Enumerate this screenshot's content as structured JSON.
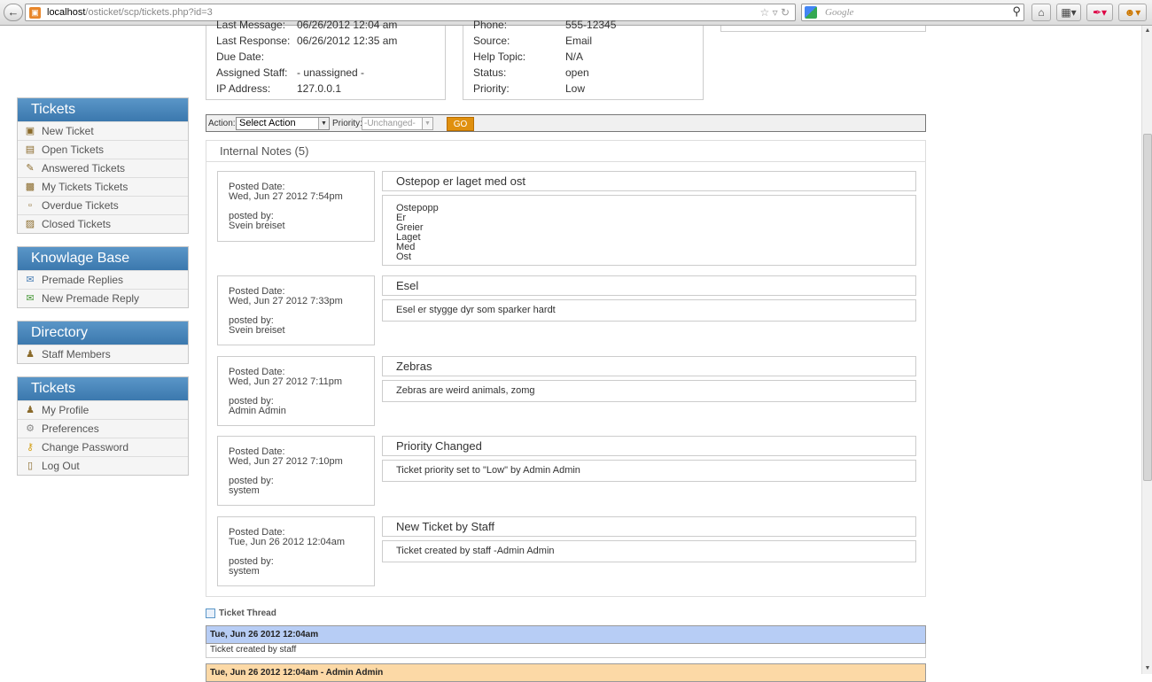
{
  "browser": {
    "url_host": "localhost",
    "url_path": "/osticket/scp/tickets.php?id=3",
    "search_placeholder": "Google"
  },
  "ticket_info_left": [
    {
      "key": "Last Message:",
      "value": "06/26/2012 12:04 am"
    },
    {
      "key": "Last Response:",
      "value": "06/26/2012 12:35 am"
    },
    {
      "key": "Due Date:",
      "value": ""
    },
    {
      "key": "Assigned Staff:",
      "value": "- unassigned -"
    },
    {
      "key": "IP Address:",
      "value": "127.0.0.1"
    }
  ],
  "ticket_info_right": [
    {
      "key": "Phone:",
      "value": "555-12345"
    },
    {
      "key": "Source:",
      "value": "Email"
    },
    {
      "key": "Help Topic:",
      "value": "N/A"
    },
    {
      "key": "Status:",
      "value": "open"
    },
    {
      "key": "Priority:",
      "value": "Low"
    }
  ],
  "sidebar": {
    "groups": [
      {
        "title": "Tickets",
        "items": [
          {
            "label": "New Ticket",
            "icon": "new-ticket-icon"
          },
          {
            "label": "Open Tickets",
            "icon": "open-tickets-icon"
          },
          {
            "label": "Answered Tickets",
            "icon": "answered-tickets-icon"
          },
          {
            "label": "My Tickets Tickets",
            "icon": "my-tickets-icon"
          },
          {
            "label": "Overdue Tickets",
            "icon": "overdue-tickets-icon"
          },
          {
            "label": "Closed Tickets",
            "icon": "closed-tickets-icon"
          }
        ]
      },
      {
        "title": "Knowlage Base",
        "items": [
          {
            "label": "Premade Replies",
            "icon": "premade-replies-icon"
          },
          {
            "label": "New Premade Reply",
            "icon": "new-premade-reply-icon"
          }
        ]
      },
      {
        "title": "Directory",
        "items": [
          {
            "label": "Staff Members",
            "icon": "staff-members-icon"
          }
        ]
      },
      {
        "title": "Tickets",
        "items": [
          {
            "label": "My Profile",
            "icon": "profile-icon"
          },
          {
            "label": "Preferences",
            "icon": "preferences-icon"
          },
          {
            "label": "Change Password",
            "icon": "key-icon"
          },
          {
            "label": "Log Out",
            "icon": "logout-icon"
          }
        ]
      }
    ]
  },
  "actionbar": {
    "action_label": "Action:",
    "action_value": "Select Action",
    "priority_label": "Priority:",
    "priority_value": "-Unchanged-",
    "go_label": "GO"
  },
  "notes": {
    "header": "Internal Notes (5)",
    "posted_date_label": "Posted Date:",
    "posted_by_label": "posted by:",
    "items": [
      {
        "date": "Wed, Jun 27 2012 7:54pm",
        "author": "Svein breiset",
        "title": "Ostepop er laget med ost",
        "body": [
          "Ostepopp",
          "Er",
          "Greier",
          "Laget",
          "Med",
          "Ost"
        ]
      },
      {
        "date": "Wed, Jun 27 2012 7:33pm",
        "author": "Svein breiset",
        "title": "Esel",
        "body": [
          "Esel er stygge dyr som sparker hardt"
        ]
      },
      {
        "date": "Wed, Jun 27 2012 7:11pm",
        "author": "Admin Admin",
        "title": "Zebras",
        "body": [
          "Zebras are weird animals, zomg"
        ]
      },
      {
        "date": "Wed, Jun 27 2012 7:10pm",
        "author": "system",
        "title": "Priority Changed",
        "body": [
          "Ticket priority set to \"Low\" by Admin Admin"
        ]
      },
      {
        "date": "Tue, Jun 26 2012 12:04am",
        "author": "system",
        "title": "New Ticket by Staff",
        "body": [
          "Ticket created by staff -Admin Admin"
        ]
      }
    ]
  },
  "thread": {
    "title": "Ticket Thread",
    "entries": [
      {
        "header": "Tue, Jun 26 2012 12:04am",
        "body": "Ticket created by staff",
        "color": "#b7cdf5"
      },
      {
        "header": "Tue, Jun 26 2012 12:04am - Admin Admin",
        "body": "",
        "color": "#fcd9a6"
      }
    ]
  }
}
